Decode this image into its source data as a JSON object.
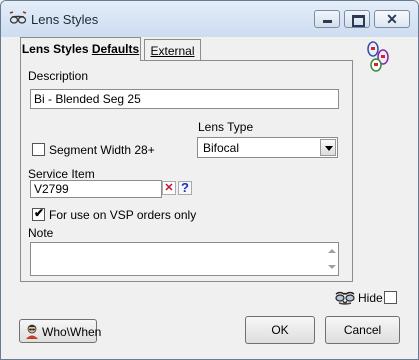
{
  "window": {
    "title": "Lens Styles",
    "close_symbol": "✕"
  },
  "tabs": [
    {
      "label_part1": "Lens Styles ",
      "label_part2": "Defaults"
    },
    {
      "label": "External"
    }
  ],
  "form": {
    "description_label": "Description",
    "description_value": "Bi - Blended Seg 25",
    "segment_width_label": "Segment Width 28+",
    "segment_width_checked": false,
    "lens_type_label": "Lens Type",
    "lens_type_value": "Bifocal",
    "service_item_label": "Service Item",
    "service_item_value": "V2799",
    "vsp_label": "For use on VSP orders only",
    "vsp_checked": true,
    "vsp_check_symbol": "✔",
    "note_label": "Note",
    "note_value": ""
  },
  "footer": {
    "hide_label": "Hide",
    "hide_checked": false,
    "who_when_label": "Who\\When",
    "ok_label": "OK",
    "cancel_label": "Cancel"
  },
  "icons": {
    "app": "glasses-icon",
    "lens_styles": "lens-styles-icon",
    "hide": "disguise-glasses-icon",
    "who_when": "person-icon"
  },
  "colors": {
    "title_bar_top": "#e4eef9",
    "title_bar_bottom": "#cddcf0",
    "window_bg": "#f0f0f0",
    "clear_red": "#c8102e",
    "help_blue": "#1b2fb5"
  }
}
